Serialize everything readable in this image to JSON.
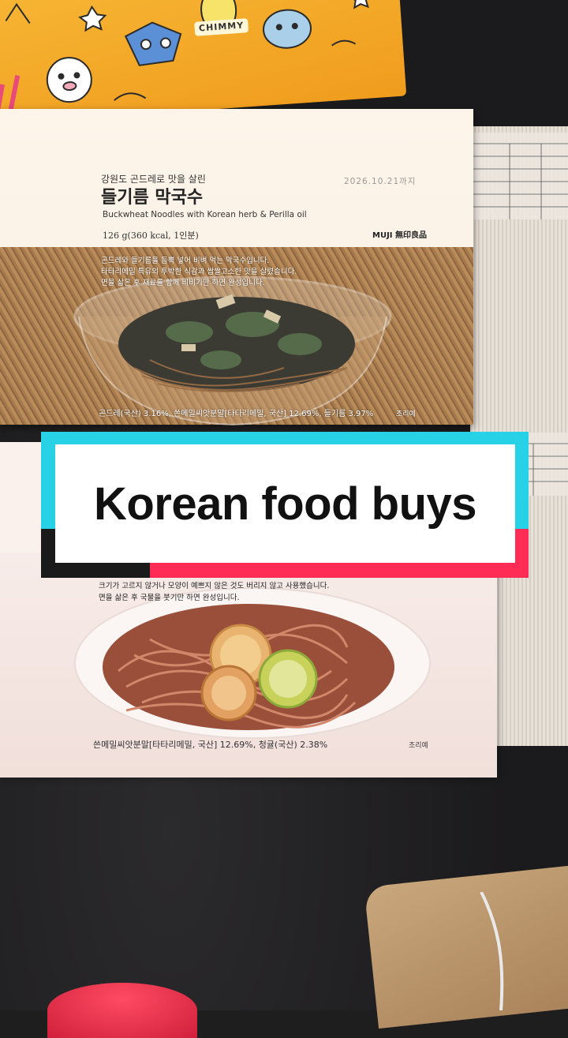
{
  "caption": {
    "text": "Korean food buys"
  },
  "box": {
    "character_tag": "CHIMMY"
  },
  "package_top": {
    "subtitle_kr": "강원도 곤드레로 맛을 살린",
    "title_kr": "들기름 막국수",
    "title_en": "Buckwheat Noodles with Korean herb & Perilla oil",
    "weight": "126 g(360 kcal, 1인분)",
    "expiry": "2026.10.21까지",
    "brand": "MUJI 無印良品",
    "description": [
      "곤드레와 들기름을 듬뿍 넣어 비벼 먹는 막국수입니다.",
      "타타리메밀 특유의 투박한 식감과 쌉쌀고소한 맛을 살렸습니다.",
      "면을 삶은 후 재료를 함께 비비기만 하면 완성입니다."
    ],
    "ingredients": "곤드레(국산) 3.16%, 쓴메밀씨앗분말[타타리메밀, 국산] 12.69%, 들기름 3.97%",
    "serving_note": "조리예"
  },
  "package_bottom": {
    "description": [
      "크기가 고르지 않거나 모양이 예쁘지 않은 것도 버리지 않고 사용했습니다.",
      "면을 삶은 후 국물을 붓기만 하면 완성입니다."
    ],
    "ingredients": "쓴메밀씨앗분말[타타리메밀, 국산] 12.69%, 청귤(국산) 2.38%",
    "serving_note": "조리예"
  },
  "colors": {
    "caption_cyan": "#27d2e6",
    "caption_red": "#ff2d55",
    "box_yellow": "#f7b634"
  }
}
